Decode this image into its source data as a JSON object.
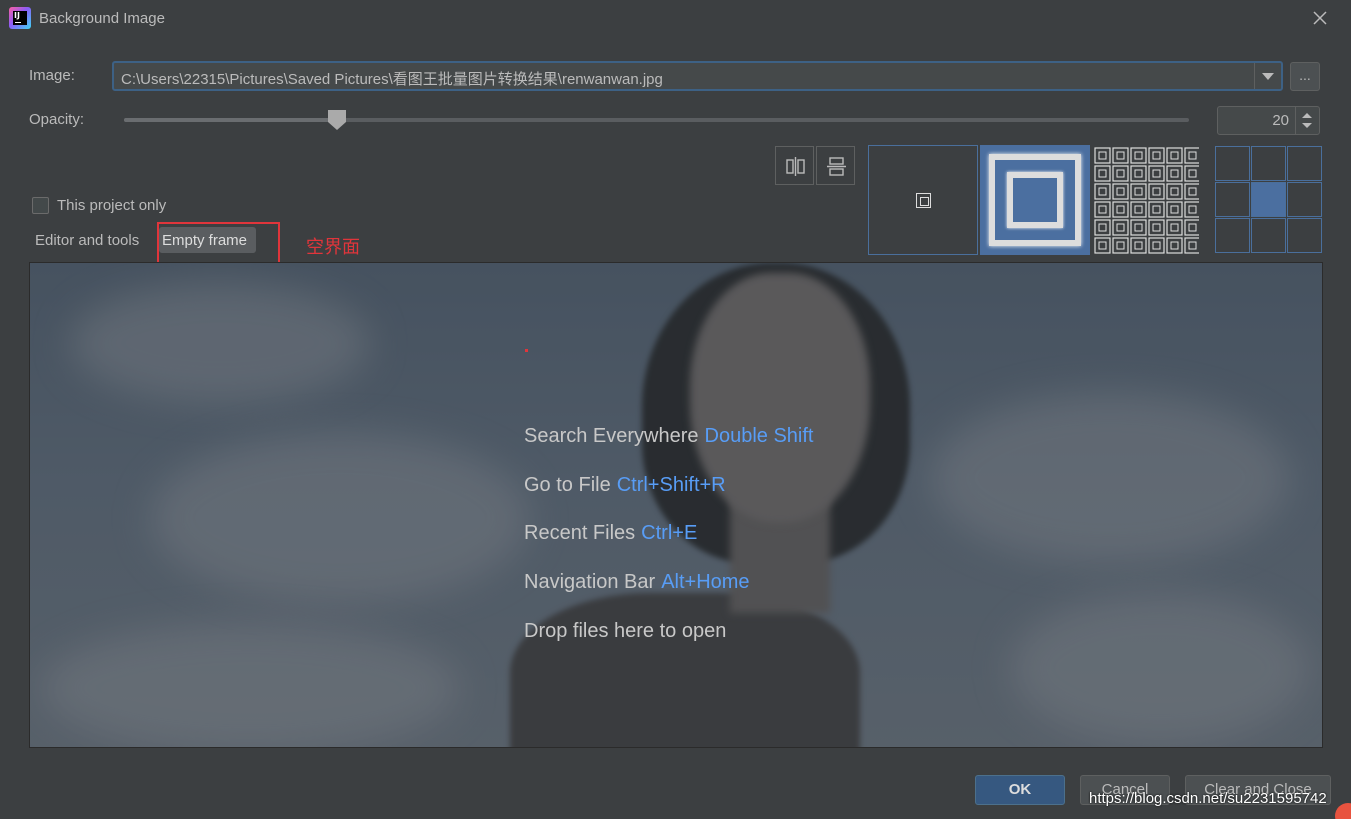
{
  "window": {
    "title": "Background Image"
  },
  "image_field": {
    "label": "Image:",
    "value": "C:\\Users\\22315\\Pictures\\Saved Pictures\\看图王批量图片转换结果\\renwanwan.jpg",
    "browse_label": "..."
  },
  "opacity": {
    "label": "Opacity:",
    "value": "20",
    "slider_fraction": 0.2
  },
  "options": {
    "this_project_only": "This project only",
    "this_project_only_checked": false
  },
  "target_tabs": {
    "editor": "Editor and tools",
    "empty_frame": "Empty frame",
    "selected": "empty_frame"
  },
  "annotation": {
    "text": "空界面",
    "color": "#e0353b"
  },
  "fill_modes": [
    "center",
    "scale",
    "tile"
  ],
  "fill_mode_selected": "scale",
  "anchor_selected": "center",
  "preview_hints": [
    {
      "action": "Search Everywhere",
      "shortcut": "Double Shift"
    },
    {
      "action": "Go to File",
      "shortcut": "Ctrl+Shift+R"
    },
    {
      "action": "Recent Files",
      "shortcut": "Ctrl+E"
    },
    {
      "action": "Navigation Bar",
      "shortcut": "Alt+Home"
    },
    {
      "action": "Drop files here to open",
      "shortcut": ""
    }
  ],
  "buttons": {
    "ok": "OK",
    "cancel": "Cancel",
    "clear_and_close": "Clear and Close"
  },
  "watermark": "https://blog.csdn.net/su2231595742",
  "colors": {
    "background": "#3c3f41",
    "accent": "#4b6fa0",
    "shortcut": "#589df6"
  }
}
